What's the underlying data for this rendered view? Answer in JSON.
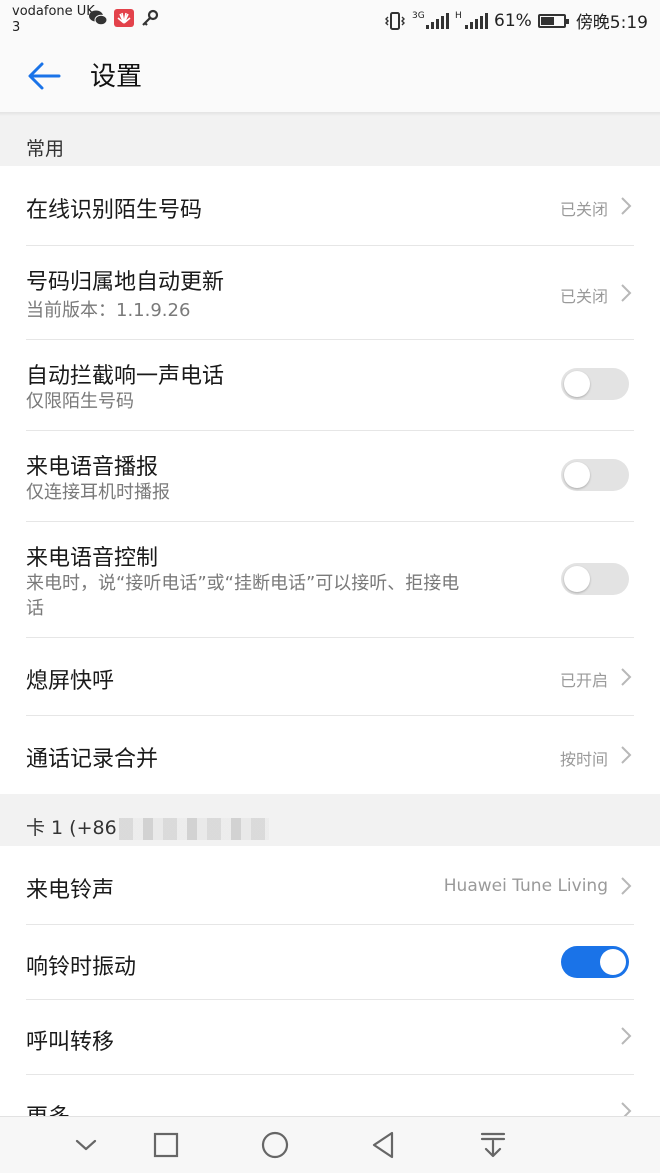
{
  "status_bar": {
    "carrier": "vodafone UK",
    "carrier_sub": "3",
    "battery_percent": "61%",
    "battery_level": 0.61,
    "time": "傍晚5:19",
    "network_label_1": "3G",
    "network_label_2": "H",
    "icons": [
      "wechat-icon",
      "huawei-icon",
      "key-icon",
      "vibrate-icon",
      "signal-icon",
      "signal-icon",
      "battery-icon"
    ]
  },
  "header": {
    "title": "设置"
  },
  "sections": {
    "common": {
      "label": "常用"
    },
    "sim1": {
      "label": "卡 1 (+86"
    }
  },
  "rows": {
    "online_id": {
      "title": "在线识别陌生号码",
      "value": "已关闭"
    },
    "location_update": {
      "title": "号码归属地自动更新",
      "subtitle": "当前版本：1.1.9.26",
      "value": "已关闭"
    },
    "block_one_ring": {
      "title": "自动拦截响一声电话",
      "subtitle": "仅限陌生号码",
      "enabled": false
    },
    "voice_announce": {
      "title": "来电语音播报",
      "subtitle": "仅连接耳机时播报",
      "enabled": false
    },
    "voice_control": {
      "title": "来电语音控制",
      "subtitle_line1": "来电时，说“接听电话”或“挂断电话”可以接听、拒接电",
      "subtitle_line2": "话",
      "enabled": false
    },
    "quick_call": {
      "title": "熄屏快呼",
      "value": "已开启"
    },
    "merge_logs": {
      "title": "通话记录合并",
      "value": "按时间"
    },
    "ringtone": {
      "title": "来电铃声",
      "value": "Huawei Tune Living"
    },
    "vibrate_ring": {
      "title": "响铃时振动",
      "enabled": true
    },
    "call_forward": {
      "title": "呼叫转移"
    },
    "more": {
      "title": "更多"
    }
  },
  "colors": {
    "accent": "#1a73e8",
    "section_bg": "#f2f2f2",
    "secondary_text": "#7a7a7a"
  },
  "nav_bar": {
    "icons": [
      "chevron-down-icon",
      "recents-square-icon",
      "home-circle-icon",
      "back-triangle-icon",
      "notification-pull-icon"
    ]
  }
}
